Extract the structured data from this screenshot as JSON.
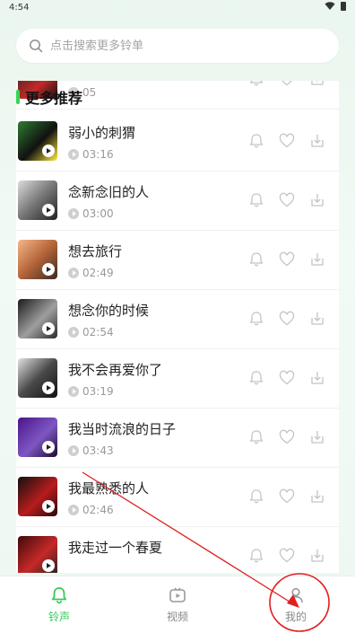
{
  "status": {
    "time": "4:54"
  },
  "search": {
    "placeholder": "点击搜索更多铃单"
  },
  "section": {
    "title": "更多推荐"
  },
  "partial_row": {
    "duration": "05"
  },
  "songs": [
    {
      "title": "弱小的刺猬",
      "duration": "03:16"
    },
    {
      "title": "念新念旧的人",
      "duration": "03:00"
    },
    {
      "title": "想去旅行",
      "duration": "02:49"
    },
    {
      "title": "想念你的时候",
      "duration": "02:54"
    },
    {
      "title": "我不会再爱你了",
      "duration": "03:19"
    },
    {
      "title": "我当时流浪的日子",
      "duration": "03:43"
    },
    {
      "title": "我最熟悉的人",
      "duration": "02:46"
    },
    {
      "title": "我走过一个春夏",
      "duration": ""
    }
  ],
  "nav": {
    "items": [
      {
        "label": "铃声",
        "icon": "bell-icon",
        "active": true
      },
      {
        "label": "视频",
        "icon": "video-icon",
        "active": false
      },
      {
        "label": "我的",
        "icon": "profile-icon",
        "active": false
      }
    ]
  },
  "colors": {
    "accent": "#39c95a",
    "annotation": "#e02020"
  }
}
